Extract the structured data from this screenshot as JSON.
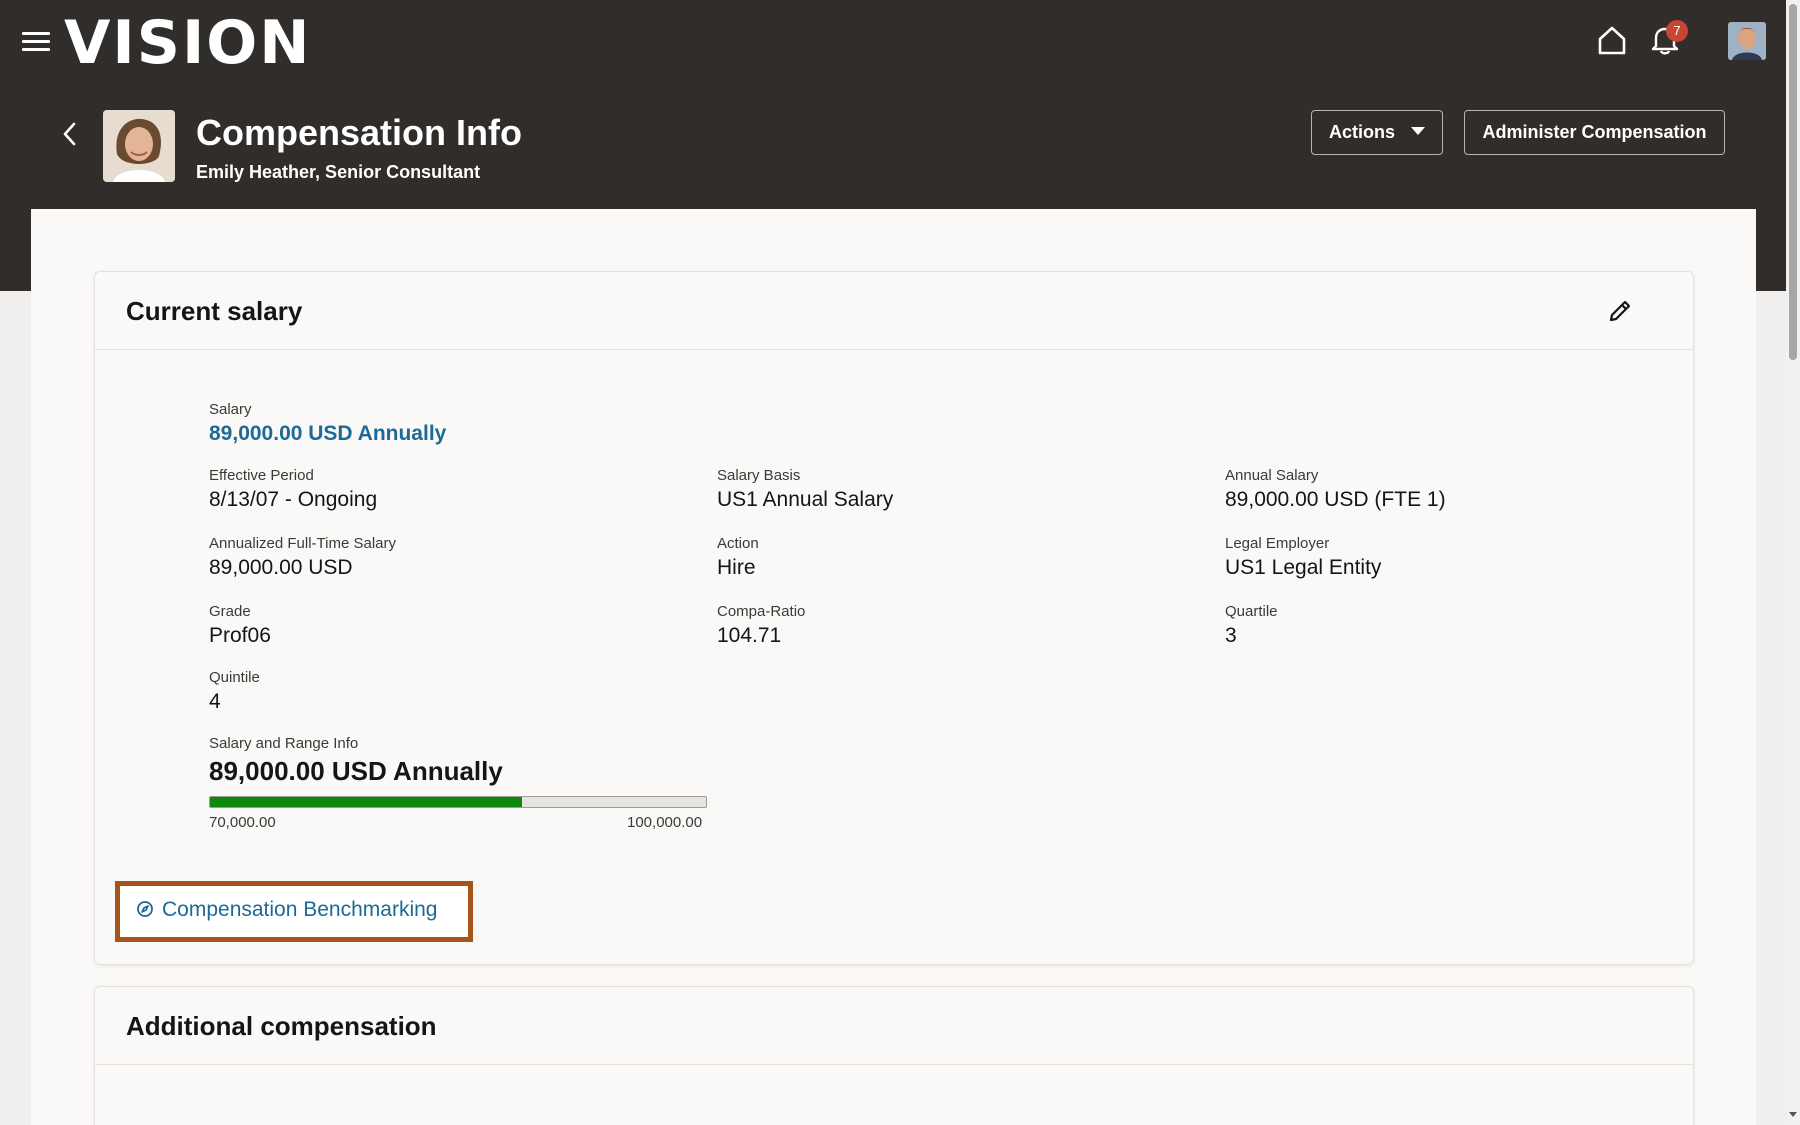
{
  "app": {
    "logo": "VISION",
    "notification_count": "7"
  },
  "header": {
    "title": "Compensation Info",
    "subtitle": "Emily Heather, Senior Consultant",
    "actions_label": "Actions",
    "administer_label": "Administer Compensation"
  },
  "current_salary": {
    "title": "Current salary",
    "salary": {
      "label": "Salary",
      "value": "89,000.00 USD Annually"
    },
    "effective_period": {
      "label": "Effective Period",
      "value": "8/13/07 - Ongoing"
    },
    "salary_basis": {
      "label": "Salary Basis",
      "value": "US1 Annual Salary"
    },
    "annual_salary": {
      "label": "Annual Salary",
      "value": "89,000.00 USD (FTE 1)"
    },
    "annualized_ft_salary": {
      "label": "Annualized Full-Time Salary",
      "value": "89,000.00 USD"
    },
    "action": {
      "label": "Action",
      "value": "Hire"
    },
    "legal_employer": {
      "label": "Legal Employer",
      "value": "US1 Legal Entity"
    },
    "grade": {
      "label": "Grade",
      "value": "Prof06"
    },
    "compa_ratio": {
      "label": "Compa-Ratio",
      "value": "104.71"
    },
    "quartile": {
      "label": "Quartile",
      "value": "3"
    },
    "quintile": {
      "label": "Quintile",
      "value": "4"
    },
    "range_info": {
      "label": "Salary and Range Info",
      "value": "89,000.00 USD Annually",
      "min": "70,000.00",
      "max": "100,000.00",
      "fill_fraction": 0.63,
      "fill_color": "#0d8a0d"
    },
    "benchmarking_link": "Compensation Benchmarking"
  },
  "additional_compensation": {
    "title": "Additional compensation"
  },
  "colors": {
    "header_bg": "#312d2a",
    "link": "#1c6a96",
    "highlight": "#a8521c",
    "badge": "#c74634"
  }
}
